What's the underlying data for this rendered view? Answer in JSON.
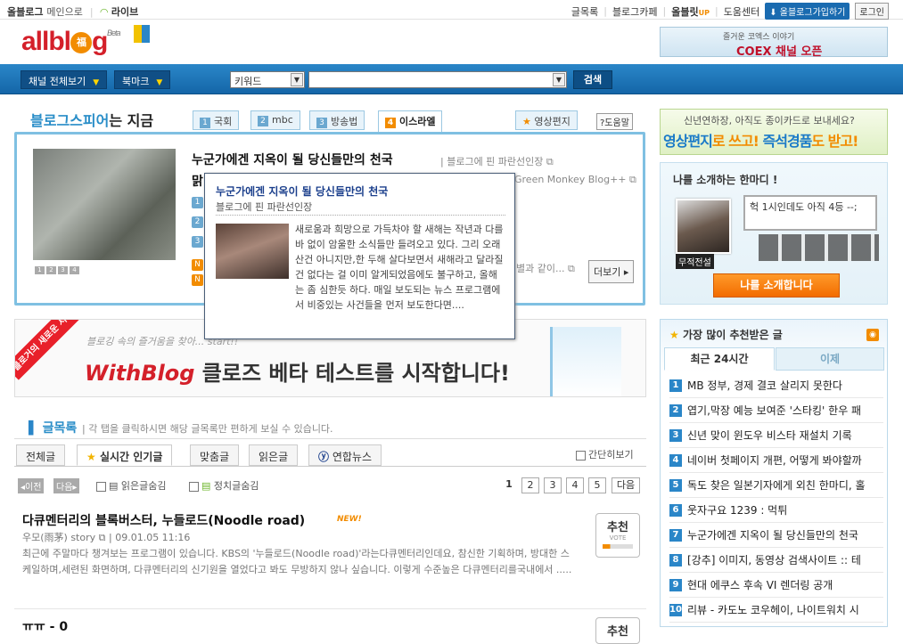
{
  "topbar": {
    "allblog": "올블로그",
    "main": "메인으로",
    "live": "라이브",
    "menu": [
      "글목록",
      "블로그카페",
      "올블릿",
      "도움센터"
    ],
    "join": "올블로그가입하기",
    "login": "로그인"
  },
  "logo": {
    "text": "allblog",
    "beta": "Beta",
    "ball": "福"
  },
  "coex": {
    "line1": "즐거운 코엑스 이야기",
    "line2": "COEX 채널 오픈"
  },
  "nav": {
    "channel": "채널 전체보기",
    "bookmark": "북마크",
    "keyword": "키워드",
    "search": "검색"
  },
  "blogspear": {
    "title_a": "블로그스피어",
    "title_b": "는 지금",
    "tabs": [
      {
        "n": "1",
        "label": "국회"
      },
      {
        "n": "2",
        "label": "mbc"
      },
      {
        "n": "3",
        "label": "방송법"
      },
      {
        "n": "4",
        "label": "이스라엘"
      }
    ],
    "video_tab": "영상편지",
    "help": "?도움말",
    "headline": "누군가에겐 지옥이 될 당신들만의 천국",
    "source": "블로그에 핀 파란선인장",
    "sub2_left": "맑",
    "sub2_right": "Green Monkey Blog++",
    "sub3_right": "별과 같이...",
    "pages": [
      "1",
      "2",
      "3",
      "4"
    ],
    "more": "더보기"
  },
  "popup": {
    "title": "누군가에겐 지옥이 될 당신들만의 천국",
    "source": "블로그에 핀 파란선인장",
    "body": "새로움과 희망으로 가득차야 할 새해는 작년과 다를 바 없이 암울한 소식들만 들려오고 있다. 그리 오래 산건 아니지만,한 두해 살다보면서 새해라고 달라질 건 없다는 걸 이미 알게되었음에도 불구하고, 올해는 좀 심한듯 하다. 매일 보도되는 뉴스 프로그램에서 비중있는 사건들을 먼저 보도한다면...."
  },
  "banner": {
    "ribbon": "블로거의 새로운 서비스",
    "hand": "블로깅 속의 즐거움을 찾아... start!!",
    "brand": "WithBlog",
    "main": " 클로즈 베타 테스트를 시작합니다!"
  },
  "list": {
    "title": "글목록",
    "desc": "각 탭을 클릭하시면 해당 글목록만 편하게 보실 수 있습니다.",
    "tabs": [
      "전체글",
      "실시간 인기글",
      "맞춤글",
      "읽은글",
      "연합뉴스"
    ],
    "simple": "간단히보기",
    "prev": "이전",
    "next": "다음",
    "opt1": "읽은글숨김",
    "opt2": "정치글숨김",
    "pages": [
      "1",
      "2",
      "3",
      "4",
      "5"
    ],
    "nextp": "다음"
  },
  "post1": {
    "title": "다큐멘터리의 블록버스터, 누들로드(Noodle road)",
    "new": "NEW!",
    "meta": "우모(雨茅) story",
    "date": "09.01.05 11:16",
    "body": "최근에 주말마다 챙겨보는 프로그램이 있습니다. KBS의 '누들로드(Noodle road)'라는다큐멘터리인데요, 참신한 기획하며, 방대한 스케일하며,세련된 화면하며, 다큐멘터리의 신기원을 열었다고 봐도 무방하지 않나 싶습니다. 이렇게 수준높은 다큐멘터리를국내에서 ....."
  },
  "post2": {
    "title": "ㅠㅠ - 0"
  },
  "recommend": {
    "label": "추천",
    "vote": "VOTE"
  },
  "videoad": {
    "line1": "신년연하장, 아직도 종이카드로 보내세요?",
    "line2a": "영상편지",
    "line2b": "로 쓰고! ",
    "line2c": "즉석경품",
    "line2d": "도 받고!"
  },
  "intro": {
    "title": "나를 소개하는 한마디 !",
    "bubble": "헉 1시인데도 아직 4등 --;",
    "name": "무적전설",
    "button": "나를 소개합니다"
  },
  "ranking": {
    "title": "가장 많이 추천받은 글",
    "tab_on": "최근 24시간",
    "tab_off": "이제",
    "items": [
      {
        "n": "1",
        "t": "MB 정부, 경제 결코 살리지 못한다"
      },
      {
        "n": "2",
        "t": "엽기,막장 예능 보여준 '스타킹' 한우 패"
      },
      {
        "n": "3",
        "t": "신년 맞이 윈도우 비스타 재설치 기록"
      },
      {
        "n": "4",
        "t": "네이버 첫페이지 개편, 어떻게 봐야할까"
      },
      {
        "n": "5",
        "t": "독도 찾은 일본기자에게 외친 한마디, 홀"
      },
      {
        "n": "6",
        "t": "웃자구요 1239 : 먹튀"
      },
      {
        "n": "7",
        "t": "누군가에겐 지옥이 될 당신들만의 천국"
      },
      {
        "n": "8",
        "t": "[강추] 이미지, 동영상 검색사이트 :: 테"
      },
      {
        "n": "9",
        "t": "현대 에쿠스 후속 VI 렌더링 공개"
      },
      {
        "n": "10",
        "t": "리뷰 - 카도노 코우헤이, 나이트워치 시"
      }
    ]
  },
  "colors": {
    "accent": "#2a86c8",
    "orange": "#f28c00",
    "red": "#d4202a"
  }
}
